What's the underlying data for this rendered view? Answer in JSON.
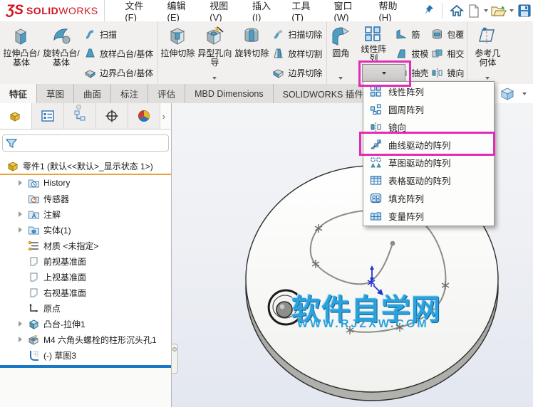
{
  "menubar": {
    "logo_mark": "ƷS",
    "logo_bold": "SOLID",
    "logo_light": "WORKS",
    "items": [
      {
        "label": "文件(F)"
      },
      {
        "label": "编辑(E)"
      },
      {
        "label": "视图(V)"
      },
      {
        "label": "插入(I)"
      },
      {
        "label": "工具(T)"
      },
      {
        "label": "窗口(W)"
      },
      {
        "label": "帮助(H)"
      }
    ]
  },
  "ribbon": {
    "group1": {
      "big": [
        {
          "label": "拉伸凸台/基体"
        },
        {
          "label": "旋转凸台/基体"
        }
      ],
      "stack": [
        {
          "label": "扫描"
        },
        {
          "label": "放样凸台/基体"
        },
        {
          "label": "边界凸台/基体"
        }
      ]
    },
    "group2": {
      "big": [
        {
          "label": "拉伸切除"
        },
        {
          "label": "异型孔向导"
        },
        {
          "label": "旋转切除"
        }
      ],
      "stack": [
        {
          "label": "扫描切除"
        },
        {
          "label": "放样切割"
        },
        {
          "label": "边界切除"
        }
      ]
    },
    "group3": {
      "big": [
        {
          "label": "圆角"
        },
        {
          "label": "线性阵列"
        }
      ],
      "stack": [
        {
          "label": "筋"
        },
        {
          "label": "拔模"
        },
        {
          "label": "抽壳"
        }
      ],
      "stack2": [
        {
          "label": "包覆"
        },
        {
          "label": "相交"
        },
        {
          "label": "镜向"
        }
      ]
    },
    "group4": {
      "big": [
        {
          "label": "参考几何体"
        }
      ]
    }
  },
  "tabs": [
    {
      "label": "特征"
    },
    {
      "label": "草图"
    },
    {
      "label": "曲面"
    },
    {
      "label": "标注"
    },
    {
      "label": "评估"
    },
    {
      "label": "MBD Dimensions"
    },
    {
      "label": "SOLIDWORKS 插件"
    }
  ],
  "pattern_menu": {
    "items": [
      {
        "label": "线性阵列"
      },
      {
        "label": "圆周阵列"
      },
      {
        "label": "镜向"
      },
      {
        "label": "曲线驱动的阵列",
        "highlighted": true
      },
      {
        "label": "草图驱动的阵列"
      },
      {
        "label": "表格驱动的阵列"
      },
      {
        "label": "填充阵列"
      },
      {
        "label": "变量阵列"
      }
    ]
  },
  "feature_tree": {
    "root": "零件1 (默认<<默认>_显示状态 1>)",
    "items": [
      {
        "label": "History"
      },
      {
        "label": "传感器"
      },
      {
        "label": "注解"
      },
      {
        "label": "实体(1)"
      },
      {
        "label": "材质 <未指定>"
      },
      {
        "label": "前视基准面"
      },
      {
        "label": "上视基准面"
      },
      {
        "label": "右视基准面"
      },
      {
        "label": "原点"
      },
      {
        "label": "凸台-拉伸1"
      },
      {
        "label": "M4 六角头螺栓的柱形沉头孔1"
      },
      {
        "label": "(-) 草图3"
      }
    ]
  },
  "viewport": {
    "watermark_title": "软件自学网",
    "watermark_url": "WWW.RJZXW.COM"
  },
  "colors": {
    "accent_magenta": "#e32bb5",
    "watermark_blue": "#2ba2dc",
    "rollback_blue": "#1878c8",
    "logo_red": "#cf1421"
  }
}
